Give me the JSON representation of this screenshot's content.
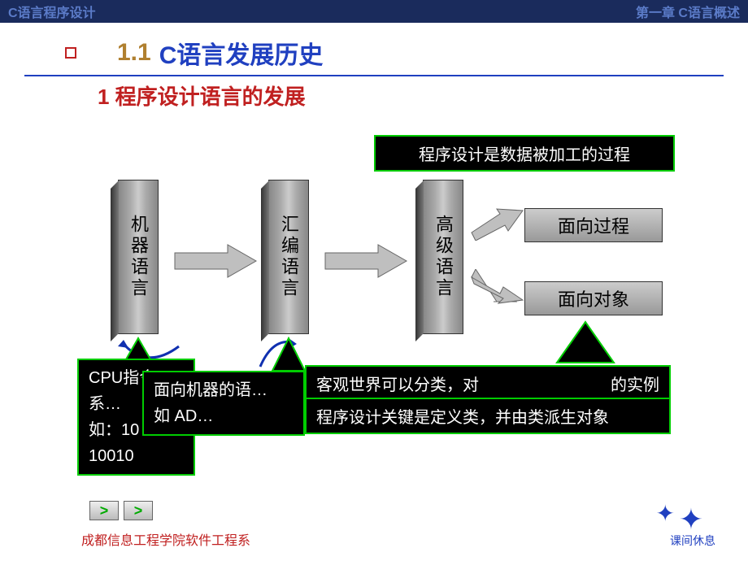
{
  "header": {
    "left": "C语言程序设计",
    "right": "第一章  C语言概述"
  },
  "section": {
    "num": "1.1",
    "title": "C语言发展历史"
  },
  "subtitle": "1 程序设计语言的发展",
  "boxes": {
    "v1": "机器语言",
    "v2": "汇编语言",
    "v3": "高级语言",
    "h1": "面向过程",
    "h2": "面向对象"
  },
  "callouts": {
    "top": "程序设计是数据被加工的过程",
    "c1_line1": "CPU指令系…",
    "c1_line2": "如：10",
    "c1_line3": "10010",
    "c2_line1": "面向机器的语…",
    "c2_line2": "如  AD…",
    "c3_line1": "客观世界可以分类，对",
    "c3_line1b": "的实例",
    "c4_line1": "程序设计关键是定义类，并由类派生对象"
  },
  "footer": {
    "left": "成都信息工程学院软件工程系",
    "right": "课间休息"
  },
  "nav": {
    "prev": ">",
    "next": ">"
  }
}
